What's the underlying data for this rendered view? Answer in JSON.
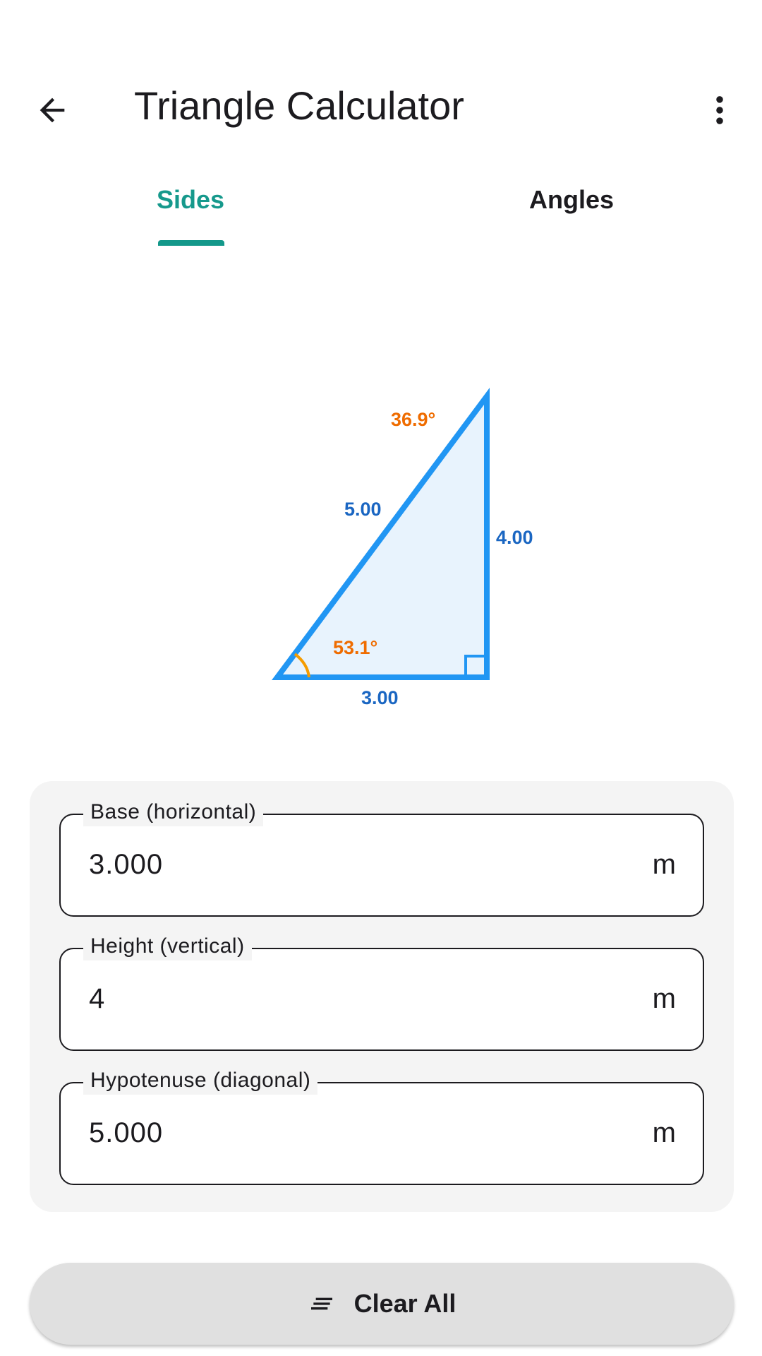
{
  "app_bar": {
    "title": "Triangle Calculator",
    "back_icon": "arrow-left-icon",
    "menu_icon": "more-vert-icon"
  },
  "tabs": [
    {
      "label": "Sides",
      "selected": true
    },
    {
      "label": "Angles",
      "selected": false
    }
  ],
  "diagram": {
    "side_hypotenuse": "5.00",
    "side_height": "4.00",
    "side_base": "3.00",
    "angle_top": "36.9°",
    "angle_bottom_left": "53.1°",
    "colors": {
      "stroke": "#2196f3",
      "fill": "#e8f3fd",
      "side_label": "#1a66c2",
      "angle_label": "#ef6c00",
      "angle_arc": "#f59c00"
    }
  },
  "fields": [
    {
      "label": "Base (horizontal)",
      "value": "3.000",
      "unit": "m"
    },
    {
      "label": "Height (vertical)",
      "value": "4",
      "unit": "m"
    },
    {
      "label": "Hypotenuse (diagonal)",
      "value": "5.000",
      "unit": "m"
    }
  ],
  "clear_button": {
    "label": "Clear All",
    "icon": "clear-all-icon"
  },
  "colors": {
    "accent": "#13988a"
  }
}
